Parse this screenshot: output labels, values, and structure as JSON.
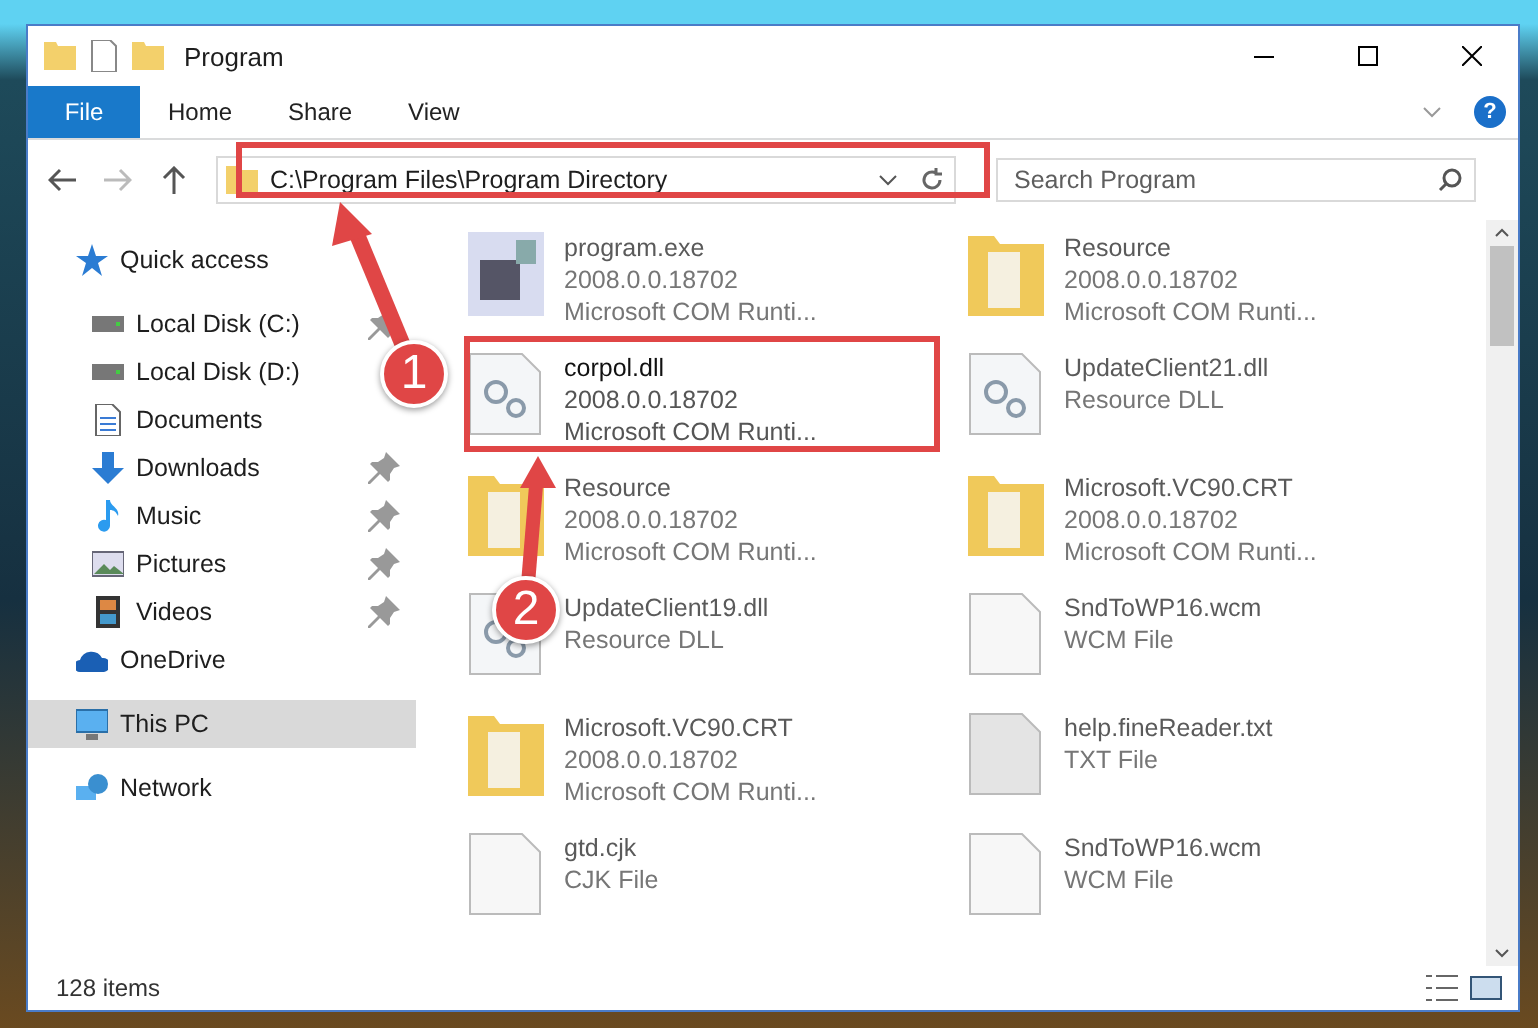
{
  "window": {
    "title": "Program"
  },
  "ribbon": {
    "tabs": [
      {
        "label": "File",
        "selected": true
      },
      {
        "label": "Home",
        "selected": false
      },
      {
        "label": "Share",
        "selected": false
      },
      {
        "label": "View",
        "selected": false
      }
    ],
    "help": "?"
  },
  "address": {
    "path": "C:\\Program Files\\Program Directory"
  },
  "search": {
    "placeholder": "Search Program"
  },
  "sidebar": {
    "items": [
      {
        "label": "Quick access",
        "kind": "star",
        "selected": false,
        "children": [
          {
            "label": "Local Disk (C:)",
            "kind": "drive",
            "pinned": true,
            "selected": false
          },
          {
            "label": "Local Disk (D:)",
            "kind": "drive",
            "pinned": false,
            "selected": false
          },
          {
            "label": "Documents",
            "kind": "document",
            "pinned": false,
            "selected": false
          },
          {
            "label": "Downloads",
            "kind": "download",
            "pinned": true,
            "selected": false
          },
          {
            "label": "Music",
            "kind": "music",
            "pinned": true,
            "selected": false
          },
          {
            "label": "Pictures",
            "kind": "pictures",
            "pinned": true,
            "selected": false
          },
          {
            "label": "Videos",
            "kind": "videos",
            "pinned": true,
            "selected": false
          }
        ]
      },
      {
        "label": "OneDrive",
        "kind": "cloud",
        "selected": false
      },
      {
        "label": "This PC",
        "kind": "pc",
        "selected": true
      },
      {
        "label": "Network",
        "kind": "network",
        "selected": false
      }
    ]
  },
  "files": [
    {
      "kind": "exe",
      "name": "program.exe",
      "lines": [
        "2008.0.0.18702",
        "Microsoft COM Runti..."
      ],
      "blurred": true
    },
    {
      "kind": "folder",
      "name": "Resource",
      "lines": [
        "2008.0.0.18702",
        "Microsoft COM Runti..."
      ],
      "blurred": true
    },
    {
      "kind": "dll",
      "name": "corpol.dll",
      "lines": [
        "2008.0.0.18702",
        "Microsoft COM Runti..."
      ],
      "blurred": false
    },
    {
      "kind": "dll",
      "name": "UpdateClient21.dll",
      "lines": [
        "Resource DLL"
      ],
      "blurred": true
    },
    {
      "kind": "folder",
      "name": "Resource",
      "lines": [
        "2008.0.0.18702",
        "Microsoft COM Runti..."
      ],
      "blurred": true
    },
    {
      "kind": "folder",
      "name": "Microsoft.VC90.CRT",
      "lines": [
        "2008.0.0.18702",
        "Microsoft COM Runti..."
      ],
      "blurred": true
    },
    {
      "kind": "dll",
      "name": "UpdateClient19.dll",
      "lines": [
        "Resource DLL"
      ],
      "blurred": true
    },
    {
      "kind": "file",
      "name": "SndToWP16.wcm",
      "lines": [
        "WCM File"
      ],
      "blurred": true
    },
    {
      "kind": "folder",
      "name": "Microsoft.VC90.CRT",
      "lines": [
        "2008.0.0.18702",
        "Microsoft COM Runti..."
      ],
      "blurred": true
    },
    {
      "kind": "text",
      "name": "help.fineReader.txt",
      "lines": [
        "TXT File"
      ],
      "blurred": true
    },
    {
      "kind": "file",
      "name": "gtd.cjk",
      "lines": [
        "CJK File"
      ],
      "blurred": true
    },
    {
      "kind": "file",
      "name": "SndToWP16.wcm",
      "lines": [
        "WCM File"
      ],
      "blurred": true
    }
  ],
  "status_bar": {
    "count": "128 items"
  },
  "annotations": [
    {
      "label": "1"
    },
    {
      "label": "2"
    }
  ]
}
